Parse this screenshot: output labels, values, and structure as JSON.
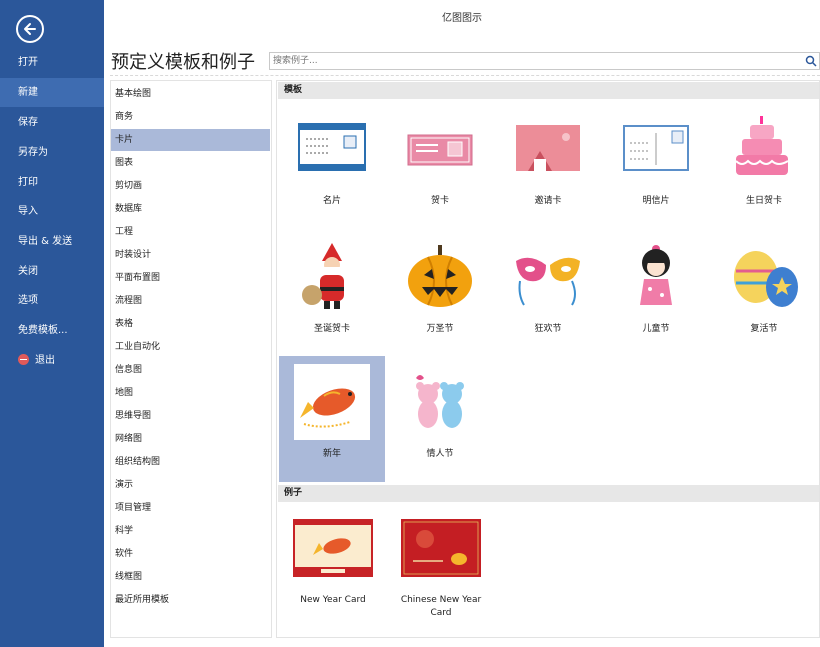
{
  "app": {
    "title": "亿图图示",
    "heading": "预定义模板和例子"
  },
  "nav": {
    "items": [
      "打开",
      "新建",
      "保存",
      "另存为",
      "打印",
      "导入",
      "导出 & 发送",
      "关闭",
      "选项",
      "免费模板..."
    ],
    "exit": "退出",
    "active_index": 1
  },
  "search": {
    "placeholder": "搜索例子..."
  },
  "categories": {
    "items": [
      "基本绘图",
      "商务",
      "卡片",
      "图表",
      "剪切画",
      "数据库",
      "工程",
      "时装设计",
      "平面布置图",
      "流程图",
      "表格",
      "工业自动化",
      "信息图",
      "地图",
      "思维导图",
      "网络图",
      "组织结构图",
      "演示",
      "项目管理",
      "科学",
      "软件",
      "线框图",
      "最近所用模板"
    ],
    "active_index": 2
  },
  "templates": {
    "header": "模板",
    "items": [
      {
        "label": "名片",
        "icon": "business-card-icon"
      },
      {
        "label": "贺卡",
        "icon": "greeting-card-icon"
      },
      {
        "label": "邀请卡",
        "icon": "invitation-card-icon"
      },
      {
        "label": "明信片",
        "icon": "postcard-icon"
      },
      {
        "label": "生日贺卡",
        "icon": "birthday-cake-icon"
      },
      {
        "label": "圣诞贺卡",
        "icon": "santa-claus-icon"
      },
      {
        "label": "万圣节",
        "icon": "pumpkin-icon"
      },
      {
        "label": "狂欢节",
        "icon": "carnival-mask-icon"
      },
      {
        "label": "儿童节",
        "icon": "doll-icon"
      },
      {
        "label": "复活节",
        "icon": "easter-egg-icon"
      },
      {
        "label": "新年",
        "icon": "carp-fish-icon"
      },
      {
        "label": "情人节",
        "icon": "teddy-bears-icon"
      }
    ],
    "active_index": 10
  },
  "examples": {
    "header": "例子",
    "items": [
      {
        "label": "New Year Card"
      },
      {
        "label": "Chinese New Year Card"
      }
    ]
  },
  "colors": {
    "sidebar": "#2b579a",
    "selected": "#aab9d9",
    "accent": "#2b579a"
  }
}
